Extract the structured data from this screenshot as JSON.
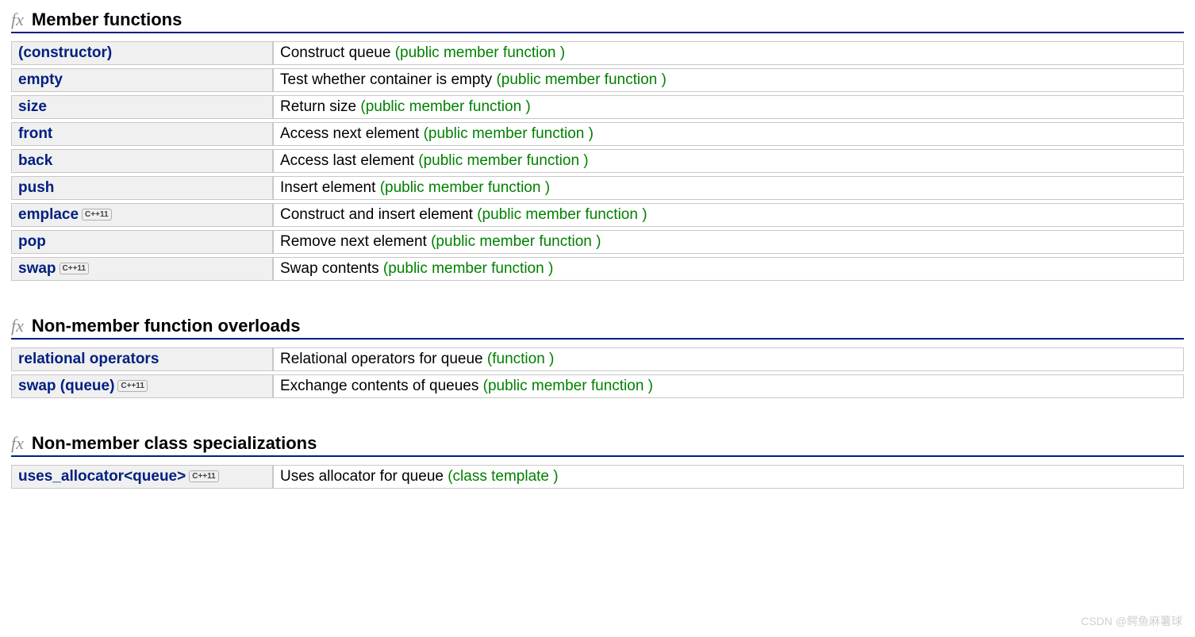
{
  "sections": [
    {
      "title": "Member functions",
      "rows": [
        {
          "name": "(constructor)",
          "badge": null,
          "desc": "Construct queue",
          "type": "(public member function )"
        },
        {
          "name": "empty",
          "badge": null,
          "desc": "Test whether container is empty",
          "type": "(public member function )"
        },
        {
          "name": "size",
          "badge": null,
          "desc": "Return size",
          "type": "(public member function )"
        },
        {
          "name": "front",
          "badge": null,
          "desc": "Access next element",
          "type": "(public member function )"
        },
        {
          "name": "back",
          "badge": null,
          "desc": "Access last element",
          "type": "(public member function )"
        },
        {
          "name": "push",
          "badge": null,
          "desc": "Insert element",
          "type": "(public member function )"
        },
        {
          "name": "emplace",
          "badge": "C++11",
          "desc": "Construct and insert element",
          "type": "(public member function )"
        },
        {
          "name": "pop",
          "badge": null,
          "desc": "Remove next element",
          "type": "(public member function )"
        },
        {
          "name": "swap",
          "badge": "C++11",
          "desc": "Swap contents",
          "type": "(public member function )"
        }
      ]
    },
    {
      "title": "Non-member function overloads",
      "rows": [
        {
          "name": "relational operators",
          "badge": null,
          "desc": "Relational operators for queue",
          "type": "(function )"
        },
        {
          "name": "swap (queue)",
          "badge": "C++11",
          "desc": "Exchange contents of queues",
          "type": "(public member function )"
        }
      ]
    },
    {
      "title": "Non-member class specializations",
      "rows": [
        {
          "name": "uses_allocator<queue>",
          "badge": "C++11",
          "desc": "Uses allocator for queue",
          "type": "(class template )"
        }
      ]
    }
  ],
  "fx_label": "fx",
  "watermark": "CSDN @鳄鱼麻薯球"
}
